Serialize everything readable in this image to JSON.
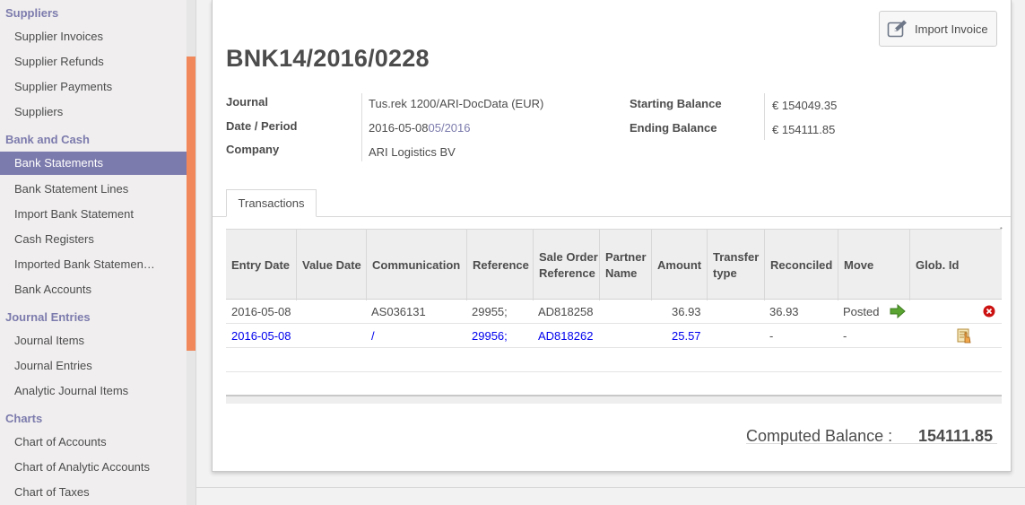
{
  "sidebar": {
    "groups": [
      {
        "heading": "Suppliers",
        "items": [
          "Supplier Invoices",
          "Supplier Refunds",
          "Supplier Payments",
          "Suppliers"
        ]
      },
      {
        "heading": "Bank and Cash",
        "items": [
          "Bank Statements",
          "Bank Statement Lines",
          "Import Bank Statement",
          "Cash Registers",
          "Imported Bank Statemen…",
          "Bank Accounts"
        ]
      },
      {
        "heading": "Journal Entries",
        "items": [
          "Journal Items",
          "Journal Entries",
          "Analytic Journal Items"
        ]
      },
      {
        "heading": "Charts",
        "items": [
          "Chart of Accounts",
          "Chart of Analytic Accounts",
          "Chart of Taxes"
        ]
      }
    ],
    "active_item": "Bank Statements"
  },
  "toolbar": {
    "import_label": "Import Invoice"
  },
  "record": {
    "title": "BNK14/2016/0228",
    "journal_label": "Journal",
    "journal_value": "Tus.rek 1200/ARI-DocData (EUR)",
    "date_label": "Date / Period",
    "date_value": "2016-05-08",
    "period_value": "05/2016",
    "company_label": "Company",
    "company_value": "ARI Logistics BV",
    "starting_label": "Starting Balance",
    "starting_value": "€ 154049.35",
    "ending_label": "Ending Balance",
    "ending_value": "€ 154111.85"
  },
  "tabs": [
    {
      "label": "Transactions"
    }
  ],
  "table": {
    "headers": [
      "Entry Date",
      "Value Date",
      "Communication",
      "Reference",
      "Sale Order Reference",
      "Partner Name",
      "Amount",
      "Transfer type",
      "Reconciled",
      "Move",
      "Glob. Id"
    ],
    "rows": [
      {
        "entry_date": "2016-05-08",
        "value_date": "",
        "communication": "AS036131",
        "reference": "29955;",
        "sale_order": "AD818258",
        "partner": "",
        "amount": "36.93",
        "transfer": "",
        "reconciled": "36.93",
        "move": "Posted"
      },
      {
        "entry_date": "2016-05-08",
        "value_date": "",
        "communication": "/",
        "reference": "29956;",
        "sale_order": "AD818262",
        "partner": "",
        "amount": "25.57",
        "transfer": "",
        "reconciled": "-",
        "move": "-"
      }
    ]
  },
  "footer": {
    "computed_label": "Computed Balance :",
    "computed_value": "154111.85"
  },
  "colors": {
    "accent": "#7c7bad",
    "scroll": "#f0885c",
    "link": "#0000ee",
    "posted_arrow": "#5aa531",
    "delete": "#cc1111"
  },
  "icons": {
    "import": "edit-icon",
    "posted": "arrow-right-icon",
    "delete": "delete-icon",
    "reconcile": "reconcile-icon"
  }
}
